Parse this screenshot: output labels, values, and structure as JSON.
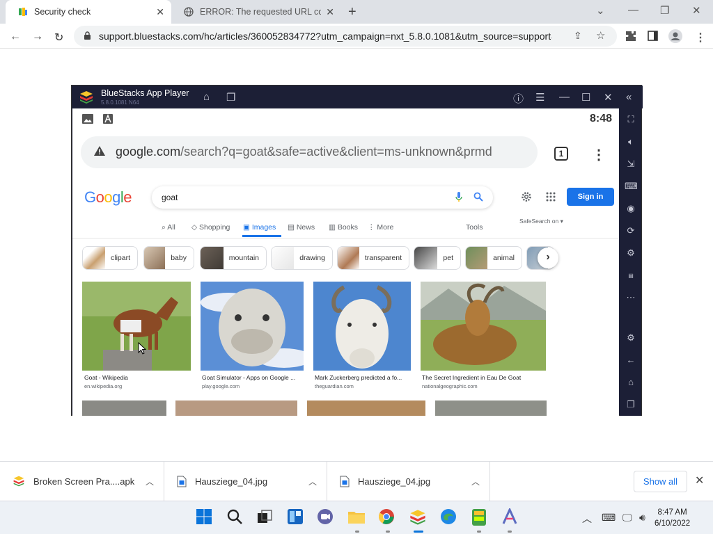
{
  "browser": {
    "tabs": [
      {
        "title": "Security check",
        "favicon": "bluestacks-favicon",
        "active": true
      },
      {
        "title": "ERROR: The requested URL could",
        "favicon": "globe-icon",
        "active": false
      }
    ],
    "url": "support.bluestacks.com/hc/articles/360052834772?utm_campaign=nxt_5.8.0.1081&utm_source=support&u..."
  },
  "bluestacks": {
    "title": "BlueStacks App Player",
    "version": "5.8.0.1081 N64",
    "status_time": "8:48",
    "mobile_url_host": "google.com",
    "mobile_url_path": "/search?q=goat&safe=active&client=ms-unknown&prmd",
    "tab_count": "1"
  },
  "google": {
    "query": "goat",
    "sign_in": "Sign in",
    "nav": [
      "All",
      "Shopping",
      "Images",
      "News",
      "Books",
      "More"
    ],
    "tools": "Tools",
    "safesearch": "SafeSearch on",
    "chips": [
      "clipart",
      "baby",
      "mountain",
      "drawing",
      "transparent",
      "pet",
      "animal"
    ],
    "results": [
      {
        "caption": "Goat - Wikipedia",
        "source": "en.wikipedia.org"
      },
      {
        "caption": "Goat Simulator - Apps on Google ...",
        "source": "play.google.com"
      },
      {
        "caption": "Mark Zuckerberg predicted a fo...",
        "source": "theguardian.com"
      },
      {
        "caption": "The Secret Ingredient in Eau De Goat",
        "source": "nationalgeographic.com"
      }
    ]
  },
  "downloads": {
    "items": [
      "Broken Screen Pra....apk",
      "Hausziege_04.jpg",
      "Hausziege_04.jpg"
    ],
    "show_all": "Show all"
  },
  "taskbar": {
    "time": "8:47 AM",
    "date": "6/10/2022"
  },
  "colors": {
    "google_blue": "#1a73e8",
    "bluestacks_frame": "#1c1f36",
    "tab_strip": "#dee1e6"
  }
}
